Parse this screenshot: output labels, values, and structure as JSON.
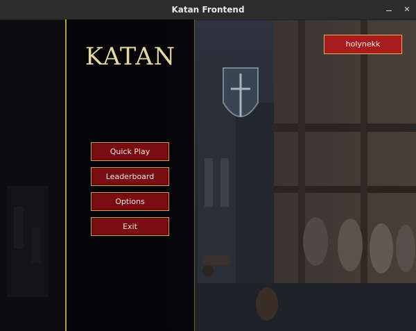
{
  "window": {
    "title": "Katan Frontend",
    "minimize_glyph": "",
    "close_glyph": "✕"
  },
  "game": {
    "logo": "KATAN"
  },
  "menu": {
    "items": [
      {
        "label": "Quick Play"
      },
      {
        "label": "Leaderboard"
      },
      {
        "label": "Options"
      },
      {
        "label": "Exit"
      }
    ]
  },
  "user": {
    "name": "holynekk"
  },
  "colors": {
    "button_bg": "#7a0d12",
    "button_border": "#d0a64c",
    "user_button_bg": "#a81c1e",
    "logo": "#e6d7a6"
  }
}
